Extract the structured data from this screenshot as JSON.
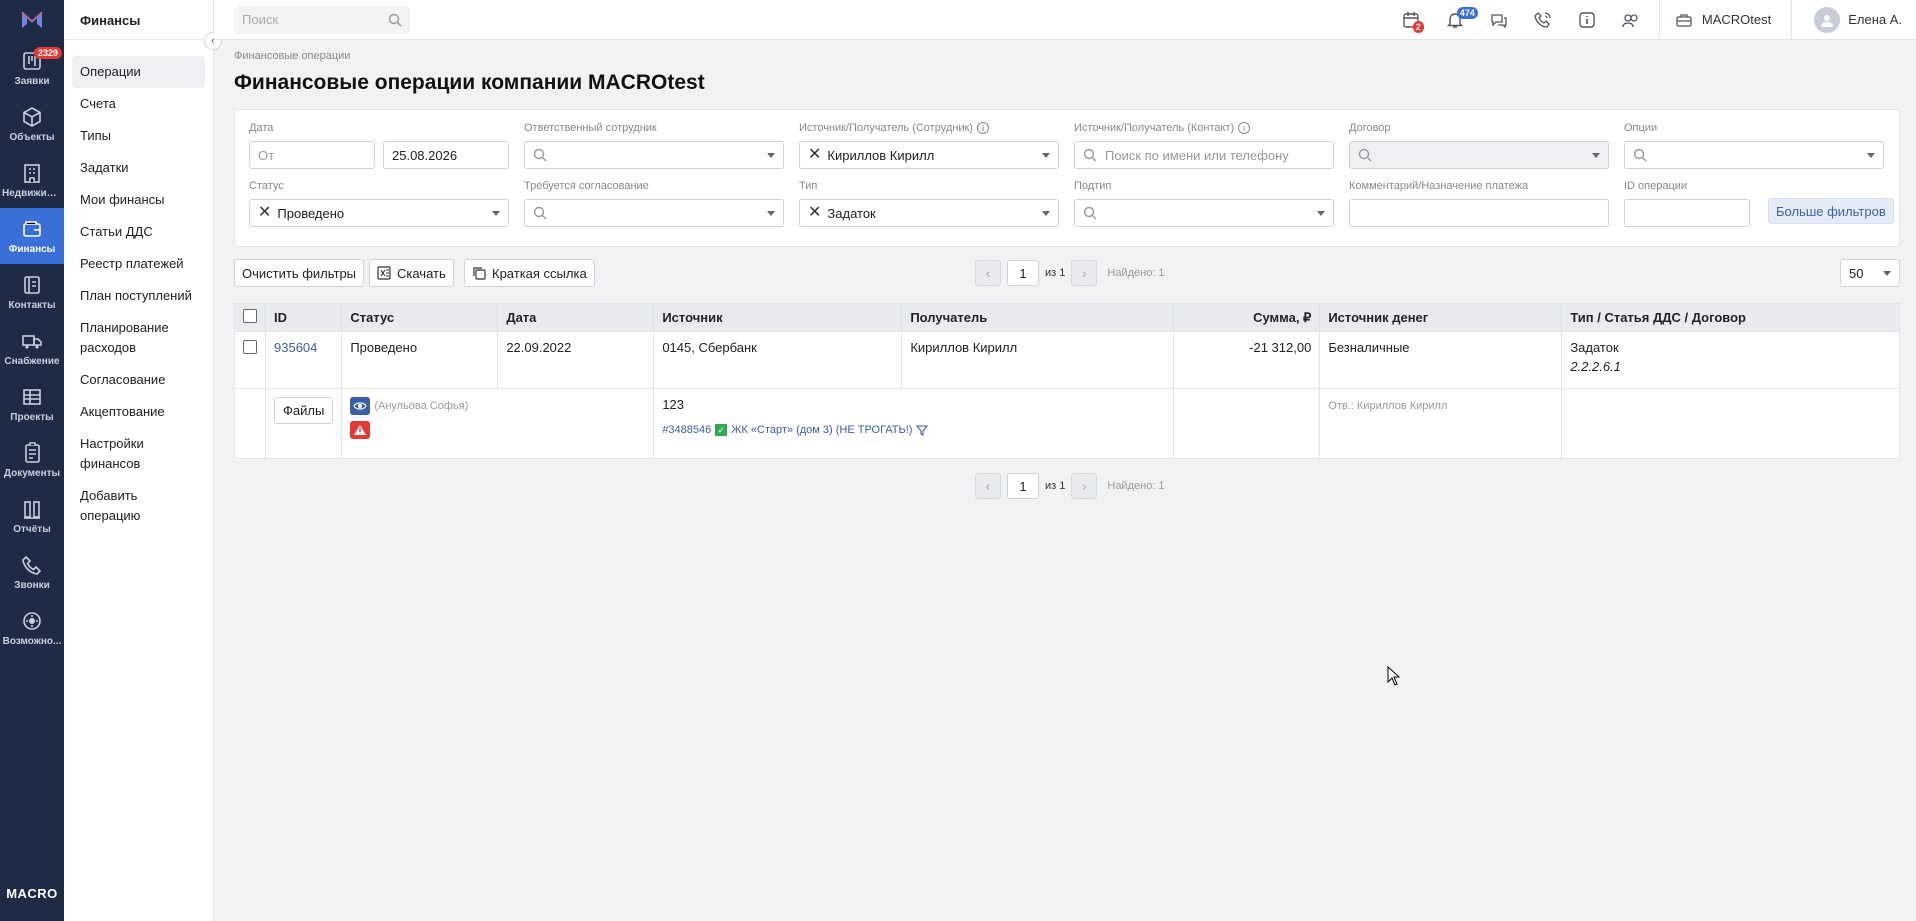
{
  "rail": {
    "items": [
      {
        "label": "Заявки",
        "icon": "board-icon",
        "badge": "2329"
      },
      {
        "label": "Объекты",
        "icon": "cube-icon"
      },
      {
        "label": "Недвижим...",
        "icon": "building-icon"
      },
      {
        "label": "Финансы",
        "icon": "wallet-icon",
        "active": true
      },
      {
        "label": "Контакты",
        "icon": "contacts-icon"
      },
      {
        "label": "Снабжение",
        "icon": "truck-icon"
      },
      {
        "label": "Проекты",
        "icon": "grid-icon"
      },
      {
        "label": "Документы",
        "icon": "document-icon"
      },
      {
        "label": "Отчёты",
        "icon": "reports-icon"
      },
      {
        "label": "Звонки",
        "icon": "phone-icon"
      },
      {
        "label": "Возможно...",
        "icon": "gear-icon"
      }
    ],
    "brand": "MACRO"
  },
  "sidebar": {
    "title": "Финансы",
    "items": [
      "Операции",
      "Счета",
      "Типы",
      "Задатки",
      "Мои финансы",
      "Статьи ДДС",
      "Реестр платежей",
      "План поступлений",
      "Планирование расходов",
      "Согласование",
      "Акцептование",
      "Настройки финансов",
      "Добавить операцию"
    ]
  },
  "topbar": {
    "search_placeholder": "Поиск",
    "calendar_badge": "2",
    "notifications_badge": "474",
    "company": "MACROtest",
    "user": "Елена А."
  },
  "page": {
    "breadcrumb": "Финансовые операции",
    "title": "Финансовые операции компании MACROtest"
  },
  "filters": {
    "date_label": "Дата",
    "date_from_placeholder": "От",
    "date_to_value": "25.08.2026",
    "responsible_label": "Ответственный сотрудник",
    "source_employee_label": "Источник/Получатель (Сотрудник)",
    "source_employee_value": "Кириллов Кирилл",
    "source_contact_label": "Источник/Получатель (Контакт)",
    "source_contact_placeholder": "Поиск по имени или телефону",
    "contract_label": "Договор",
    "options_label": "Опции",
    "status_label": "Статус",
    "status_value": "Проведено",
    "approval_label": "Требуется согласование",
    "type_label": "Тип",
    "type_value": "Задаток",
    "subtype_label": "Подтип",
    "comment_label": "Комментарий/Назначение платежа",
    "op_id_label": "ID операции",
    "more_filters": "Больше фильтров"
  },
  "actions": {
    "clear": "Очистить фильтры",
    "download": "Скачать",
    "short_link": "Краткая ссылка",
    "page": "1",
    "of": "из 1",
    "found": "Найдено: 1",
    "per_page": "50"
  },
  "table": {
    "headers": [
      "ID",
      "Статус",
      "Дата",
      "Источник",
      "Получатель",
      "Сумма, ₽",
      "Источник денег",
      "Тип / Статья ДДС / Договор"
    ],
    "row": {
      "id": "935604",
      "status": "Проведено",
      "date": "22.09.2022",
      "source": "0145, Сбербанк",
      "recipient": "Кириллов Кирилл",
      "amount": "-21 312,00",
      "money_source": "Безналичные",
      "type": "Задаток",
      "dds": "2.2.2.6.1"
    },
    "detail": {
      "files_button": "Файлы",
      "author": "(Анульова Софья)",
      "comment": "123",
      "deal_id": "#3488546",
      "deal_name": "ЖК «Старт» (дом 3) (НЕ ТРОГАТЬ!)",
      "responsible": "Отв.: Кириллов Кирилл"
    }
  },
  "colors": {
    "rail_bg": "#1f2a44",
    "accent": "#3b6fd8",
    "badge_red": "#e53935"
  }
}
